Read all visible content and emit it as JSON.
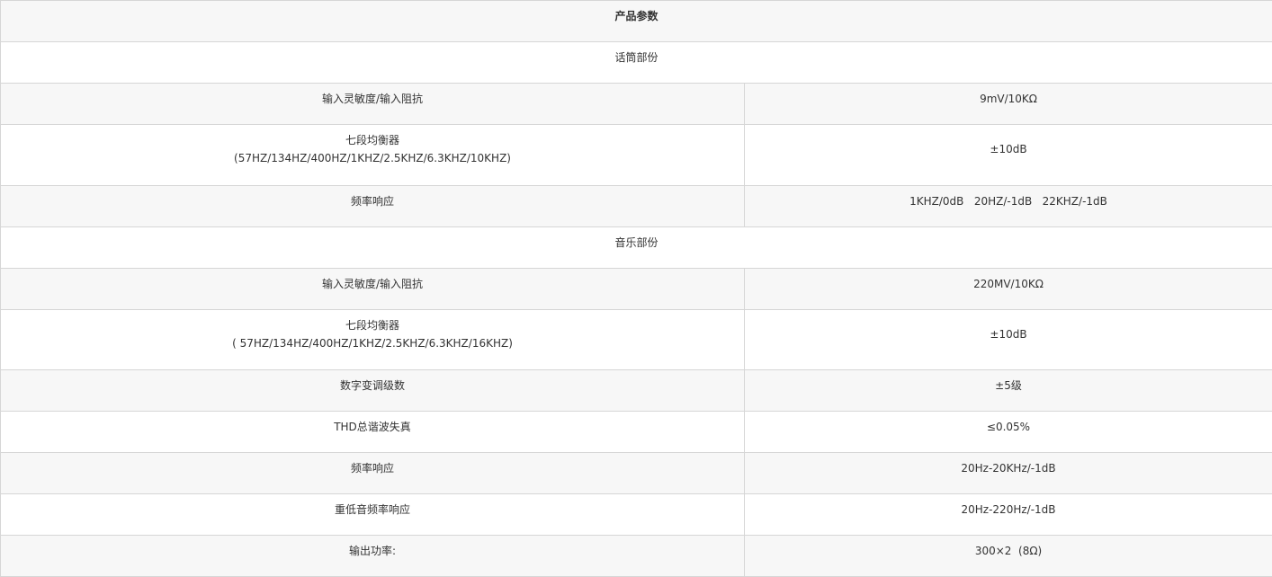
{
  "table": {
    "title": "产品参数",
    "sections": {
      "mic": {
        "heading": "话筒部份",
        "rows": [
          {
            "label": "输入灵敏度/输入阻抗",
            "value": "9mV/10KΩ"
          },
          {
            "label": "七段均衡器",
            "sublabel": "(57HZ/134HZ/400HZ/1KHZ/2.5KHZ/6.3KHZ/10KHZ)",
            "value": "±10dB"
          },
          {
            "label": "频率响应",
            "value": "1KHZ/0dB   20HZ/-1dB   22KHZ/-1dB"
          }
        ]
      },
      "music": {
        "heading": "音乐部份",
        "rows": [
          {
            "label": "输入灵敏度/输入阻抗",
            "value": "220MV/10KΩ"
          },
          {
            "label": "七段均衡器",
            "sublabel": "( 57HZ/134HZ/400HZ/1KHZ/2.5KHZ/6.3KHZ/16KHZ)",
            "value": "±10dB"
          },
          {
            "label": "数字变调级数",
            "value": "±5级"
          },
          {
            "label": "THD总谐波失真",
            "value": "≤0.05%"
          },
          {
            "label": "频率响应",
            "value": "20Hz-20KHz/-1dB"
          },
          {
            "label": "重低音频率响应",
            "value": "20Hz-220Hz/-1dB"
          },
          {
            "label": "输出功率:",
            "value": "300×2  (8Ω)"
          }
        ]
      }
    }
  }
}
